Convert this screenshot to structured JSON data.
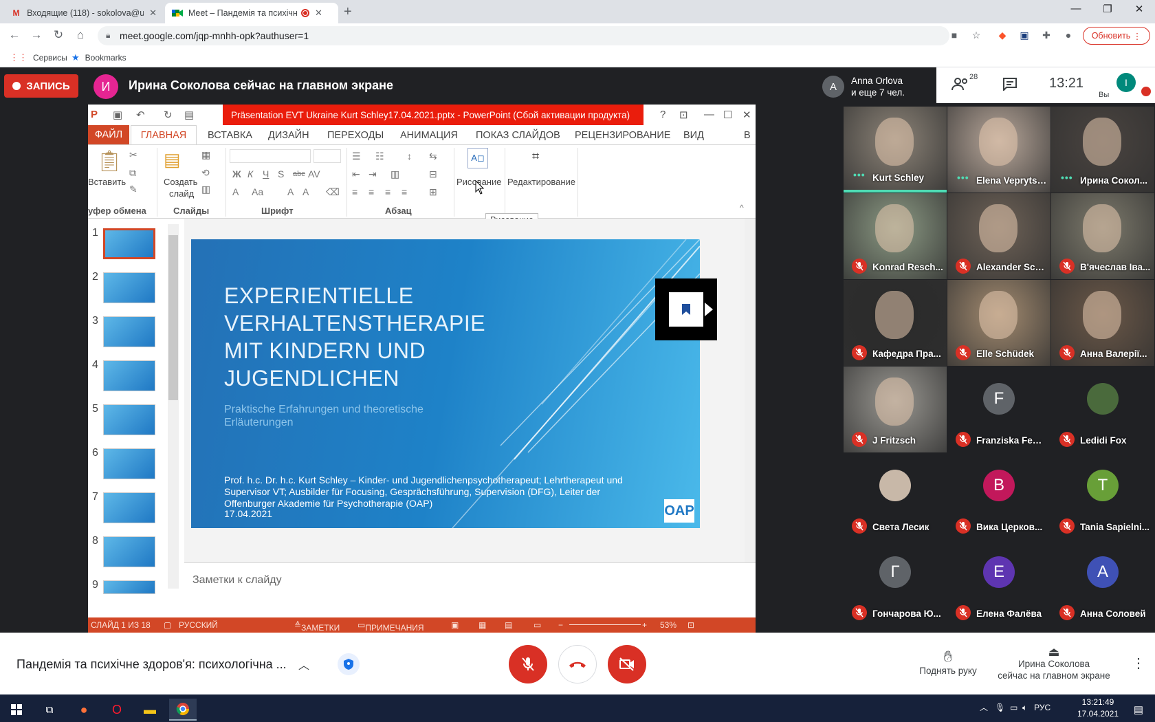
{
  "browser": {
    "tabs": [
      {
        "title": "Входящие (118) - sokolova@uip...",
        "favicon": "gmail-icon"
      },
      {
        "title": "Meet – Пандемія та психічн...",
        "favicon": "meet-icon"
      }
    ],
    "url": "meet.google.com/jqp-mnhh-opk?authuser=1",
    "update_label": "Обновить",
    "bookmarks": [
      "Сервисы",
      "Bookmarks"
    ]
  },
  "meet": {
    "record_label": "ЗАПИСЬ",
    "presenter_initial": "И",
    "presenter_banner": "Ирина Соколова сейчас на главном экране",
    "others": {
      "initial": "A",
      "line1": "Anna Orlova",
      "line2": "и еще 7 чел."
    },
    "participant_count": "28",
    "clock": "13:21",
    "self_initial": "I",
    "self_label": "Вы",
    "meeting_title": "Пандемія та психічне здоров'я: психологічна ...",
    "raise_hand": "Поднять руку",
    "presenting_line1": "Ирина Соколова",
    "presenting_line2": "сейчас на главном экране"
  },
  "ppt": {
    "title": "Präsentation EVT Ukraine  Kurt Schley17.04.2021.pptx -  PowerPoint (Сбой активации продукта)",
    "tab_file": "ФАЙЛ",
    "tab_home": "ГЛАВНАЯ",
    "tabs": [
      "ВСТАВКА",
      "ДИЗАЙН",
      "ПЕРЕХОДЫ",
      "АНИМАЦИЯ",
      "ПОКАЗ СЛАЙДОВ",
      "РЕЦЕНЗИРОВАНИЕ",
      "ВИД",
      "В"
    ],
    "ribbon": {
      "paste": "Вставить",
      "new_slide_1": "Создать",
      "new_slide_2": "слайд",
      "drawing": "Рисование",
      "editing": "Редактирование",
      "grp_clipboard": "уфер обмена",
      "grp_slides": "Слайды",
      "grp_font": "Шрифт",
      "grp_paragraph": "Абзац",
      "tooltip": "Рисование"
    },
    "thumb_numbers": [
      "1",
      "2",
      "3",
      "4",
      "5",
      "6",
      "7",
      "8",
      "9"
    ],
    "slide": {
      "title": "EXPERIENTIELLE VERHALTENSTHERAPIE MIT KINDERN UND JUGENDLICHEN",
      "subtitle": "Praktische Erfahrungen und theoretische Erläuterungen",
      "author": "Prof. h.c. Dr. h.c. Kurt Schley – Kinder- und Jugendlichenpsychotherapeut; Lehrtherapeut und Supervisor VT; Ausbilder für Focusing, Gesprächsführung, Supervision (DFG), Leiter der Offenburger Akademie für Psychotherapie (OAP)",
      "date": "17.04.2021",
      "logo": "OAP"
    },
    "notes_placeholder": "Заметки к слайду",
    "status": {
      "slide": "СЛАЙД 1 ИЗ 18",
      "lang": "РУССКИЙ",
      "notes": "ЗАМЕТКИ",
      "comments": "ПРИМЕЧАНИЯ",
      "zoom": "53%"
    }
  },
  "participants": [
    {
      "name": "Kurt Schley",
      "muted": false,
      "speaking": true,
      "video": true,
      "bg": "#8d8478"
    },
    {
      "name": "Elena Veprytska",
      "muted": false,
      "speaking": true,
      "video": true,
      "bg": "#b8a79a"
    },
    {
      "name": "Ирина Сокол...",
      "muted": false,
      "speaking": true,
      "video": true,
      "bg": "#4a4440"
    },
    {
      "name": "Konrad Resch...",
      "muted": true,
      "video": true,
      "bg": "#8c9a84"
    },
    {
      "name": "Alexander Sch...",
      "muted": true,
      "video": true,
      "bg": "#6e6257"
    },
    {
      "name": "В'ячеслав Іва...",
      "muted": true,
      "video": true,
      "bg": "#7d7a6c"
    },
    {
      "name": "Кафедра Пра...",
      "muted": true,
      "video": true,
      "bg": "#2a2a2a"
    },
    {
      "name": "Elle Schüdek",
      "muted": true,
      "video": true,
      "bg": "#a38b70"
    },
    {
      "name": "Анна Валерії...",
      "muted": true,
      "video": true,
      "bg": "#6b5848"
    },
    {
      "name": "J Fritzsch",
      "muted": true,
      "video": true,
      "bg": "#9a9892"
    },
    {
      "name": "Franziska Fehr...",
      "muted": true,
      "video": false,
      "initial": "F",
      "color": "#5f6368"
    },
    {
      "name": "Ledidi Fox",
      "muted": true,
      "video": false,
      "initial": "",
      "color": "#4a6a3c"
    },
    {
      "name": "Света Лесик",
      "muted": true,
      "video": false,
      "initial": "",
      "color": "#c8b8a8"
    },
    {
      "name": "Вика Церков...",
      "muted": true,
      "video": false,
      "initial": "B",
      "color": "#c2185b"
    },
    {
      "name": "Tania Sapielni...",
      "muted": true,
      "video": false,
      "initial": "T",
      "color": "#689f38"
    },
    {
      "name": "Гончарова Ю...",
      "muted": true,
      "video": false,
      "initial": "Г",
      "color": "#5f6368"
    },
    {
      "name": "Елена Фалёва",
      "muted": true,
      "video": false,
      "initial": "E",
      "color": "#5e35b1"
    },
    {
      "name": "Анна Соловей",
      "muted": true,
      "video": false,
      "initial": "A",
      "color": "#3f51b5"
    }
  ],
  "taskbar": {
    "lang": "РУС",
    "time": "13:21:49",
    "date": "17.04.2021"
  }
}
